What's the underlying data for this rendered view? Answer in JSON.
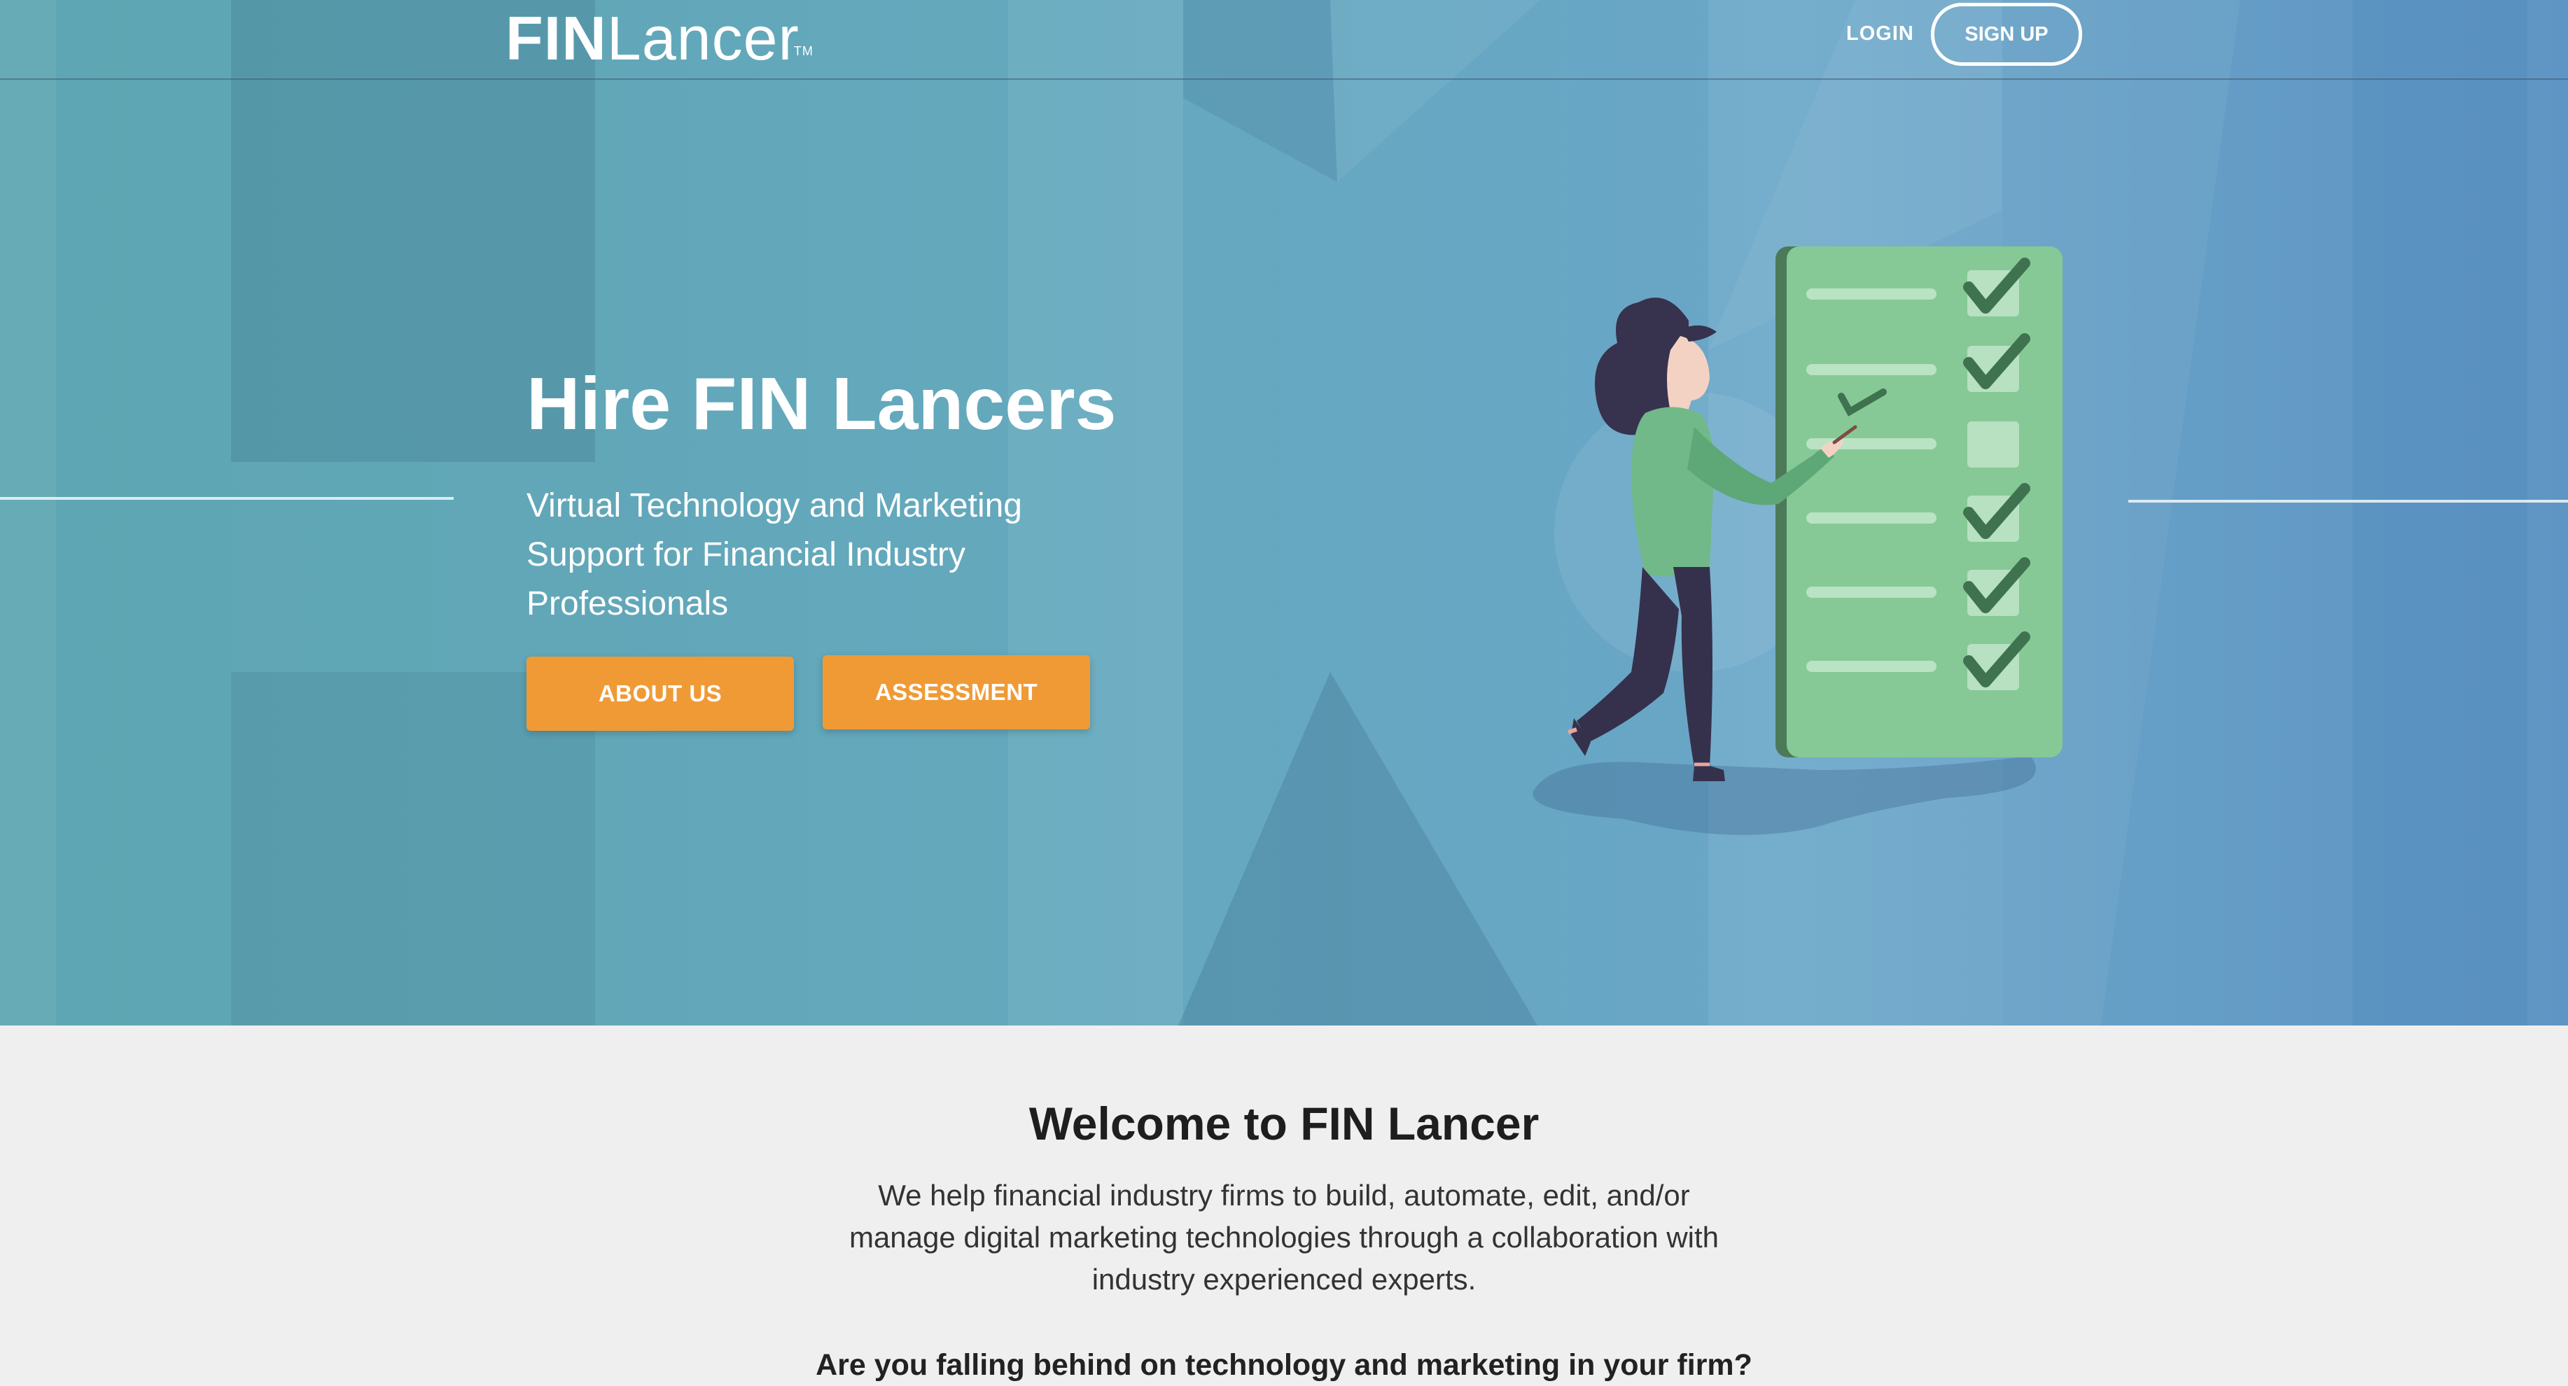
{
  "header": {
    "logo": {
      "fin": "FIN",
      "lancer": "Lancer",
      "tm": "TM"
    },
    "login_label": "LOGIN",
    "signup_label": "SIGN UP"
  },
  "hero": {
    "title": "Hire FIN Lancers",
    "subtitle": "Virtual Technology and Marketing Support for Financial Industry Professionals",
    "buttons": [
      {
        "label": "ABOUT US"
      },
      {
        "label": "ASSESSMENT"
      }
    ],
    "illustration": "woman-checklist-illustration",
    "checklist": [
      {
        "checked": true
      },
      {
        "checked": true
      },
      {
        "checked": false
      },
      {
        "checked": true
      },
      {
        "checked": true
      },
      {
        "checked": true
      }
    ]
  },
  "welcome": {
    "title": "Welcome to FIN Lancer",
    "body": "We help financial industry firms to build, automate, edit, and/or manage digital marketing technologies through a collaboration with industry experienced experts.",
    "question": "Are you falling behind on technology and marketing in your firm?"
  },
  "colors": {
    "accent_orange": "#f09a36",
    "hero_blue": "#64a8bd",
    "checklist_green": "#86c996",
    "page_bg": "#efefef"
  }
}
